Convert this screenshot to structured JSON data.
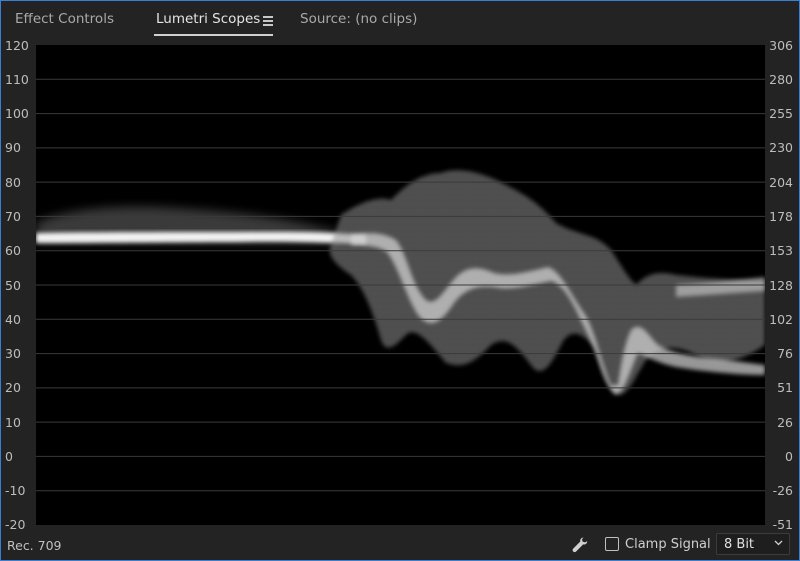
{
  "tabs": [
    {
      "label": "Effect Controls",
      "active": false
    },
    {
      "label": "Lumetri Scopes",
      "active": true
    },
    {
      "label": "Source: (no clips)",
      "active": false
    }
  ],
  "scope": {
    "left_scale": [
      "120",
      "110",
      "100",
      "90",
      "80",
      "70",
      "60",
      "50",
      "40",
      "30",
      "20",
      "10",
      "0",
      "-10",
      "-20"
    ],
    "right_scale": [
      "306",
      "280",
      "255",
      "230",
      "204",
      "178",
      "153",
      "128",
      "102",
      "76",
      "51",
      "26",
      "0",
      "-26",
      "-51"
    ],
    "background_color": "#000000",
    "trace_color": "#ffffff",
    "gridline_color": "#3a3a3a"
  },
  "footer": {
    "color_space": "Rec. 709",
    "settings_icon": "wrench-icon",
    "clamp_signal_label": "Clamp Signal",
    "clamp_signal_checked": false,
    "bit_depth": "8 Bit"
  },
  "colors": {
    "accent_border": "#3b7ed6",
    "panel_bg": "#232323"
  }
}
